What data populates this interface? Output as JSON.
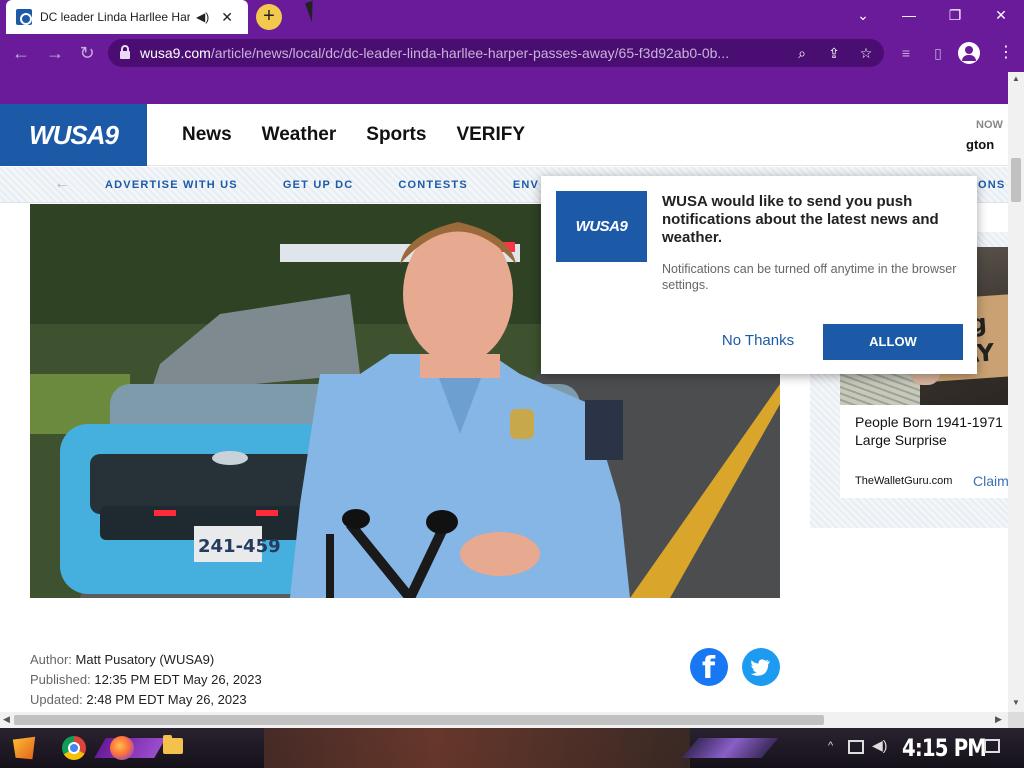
{
  "browser": {
    "tab_title": "DC leader Linda Harllee Harper passes away",
    "new_tab_symbol": "+",
    "url_host": "wusa9.com",
    "url_path": "/article/news/local/dc/dc-leader-linda-harllee-harper-passes-away/65-f3d92ab0-0b...",
    "window_controls": {
      "tab_list": "⌄",
      "minimize": "—",
      "restore": "❐",
      "close": "✕"
    }
  },
  "site": {
    "logo": "WUSA9",
    "nav": [
      "News",
      "Weather",
      "Sports",
      "VERIFY"
    ],
    "header_right_top": "NOW",
    "header_right_bottom": "gton",
    "sub_nav": [
      "ADVERTISE WITH US",
      "GET UP DC",
      "CONTESTS",
      "ENV"
    ],
    "sub_nav_right": "ONS"
  },
  "notification": {
    "logo": "WUSA9",
    "title": "WUSA would like to send you push notifications about the latest news and weather.",
    "subtitle": "Notifications can be turned off anytime in the browser settings.",
    "no_thanks": "No Thanks",
    "allow": "ALLOW"
  },
  "ad": {
    "sign_text_1": "Big",
    "sign_text_2": "PAY",
    "headline_1": "People Born 1941-1971",
    "headline_2": "Large Surprise",
    "source": "TheWalletGuru.com",
    "cta": "Claim"
  },
  "photo": {
    "plate": "241-459"
  },
  "byline": {
    "author_label": "Author:",
    "author": "Matt Pusatory (WUSA9)",
    "published_label": "Published:",
    "published": "12:35 PM EDT May 26, 2023",
    "updated_label": "Updated:",
    "updated": "2:48 PM EDT May 26, 2023"
  },
  "taskbar": {
    "clock": "4:15 PM"
  },
  "colors": {
    "browser_purple": "#6a1b9a",
    "wusa_blue": "#1c5aa8",
    "facebook_blue": "#1877f2",
    "twitter_blue": "#1d9bf0"
  }
}
